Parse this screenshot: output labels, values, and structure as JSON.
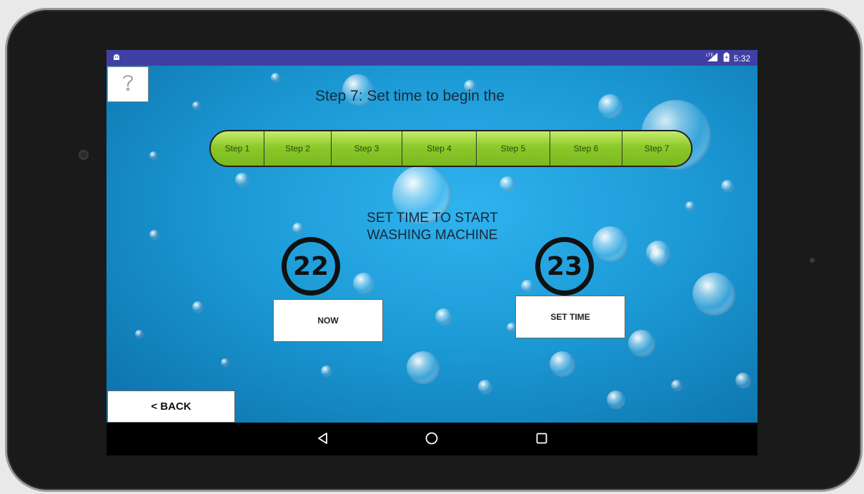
{
  "status_bar": {
    "time": "5:32",
    "network_label": "LTE"
  },
  "header": {
    "help_icon": "question-mark-icon",
    "step_title": "Step 7: Set time to begin the"
  },
  "progress": {
    "steps": [
      "Step 1",
      "Step 2",
      "Step 3",
      "Step 4",
      "Step 5",
      "Step 6",
      "Step 7"
    ],
    "fill_color": "#8cc92a"
  },
  "main": {
    "instruction_line1": "SET TIME TO START",
    "instruction_line2": "WASHING MACHINE",
    "timer_now": "22",
    "timer_set": "23",
    "now_button": "NOW",
    "set_time_button": "SET TIME"
  },
  "footer": {
    "back_button": "< BACK"
  },
  "nav_bar": {
    "icons": [
      "back-triangle-icon",
      "home-circle-icon",
      "recents-square-icon"
    ]
  }
}
